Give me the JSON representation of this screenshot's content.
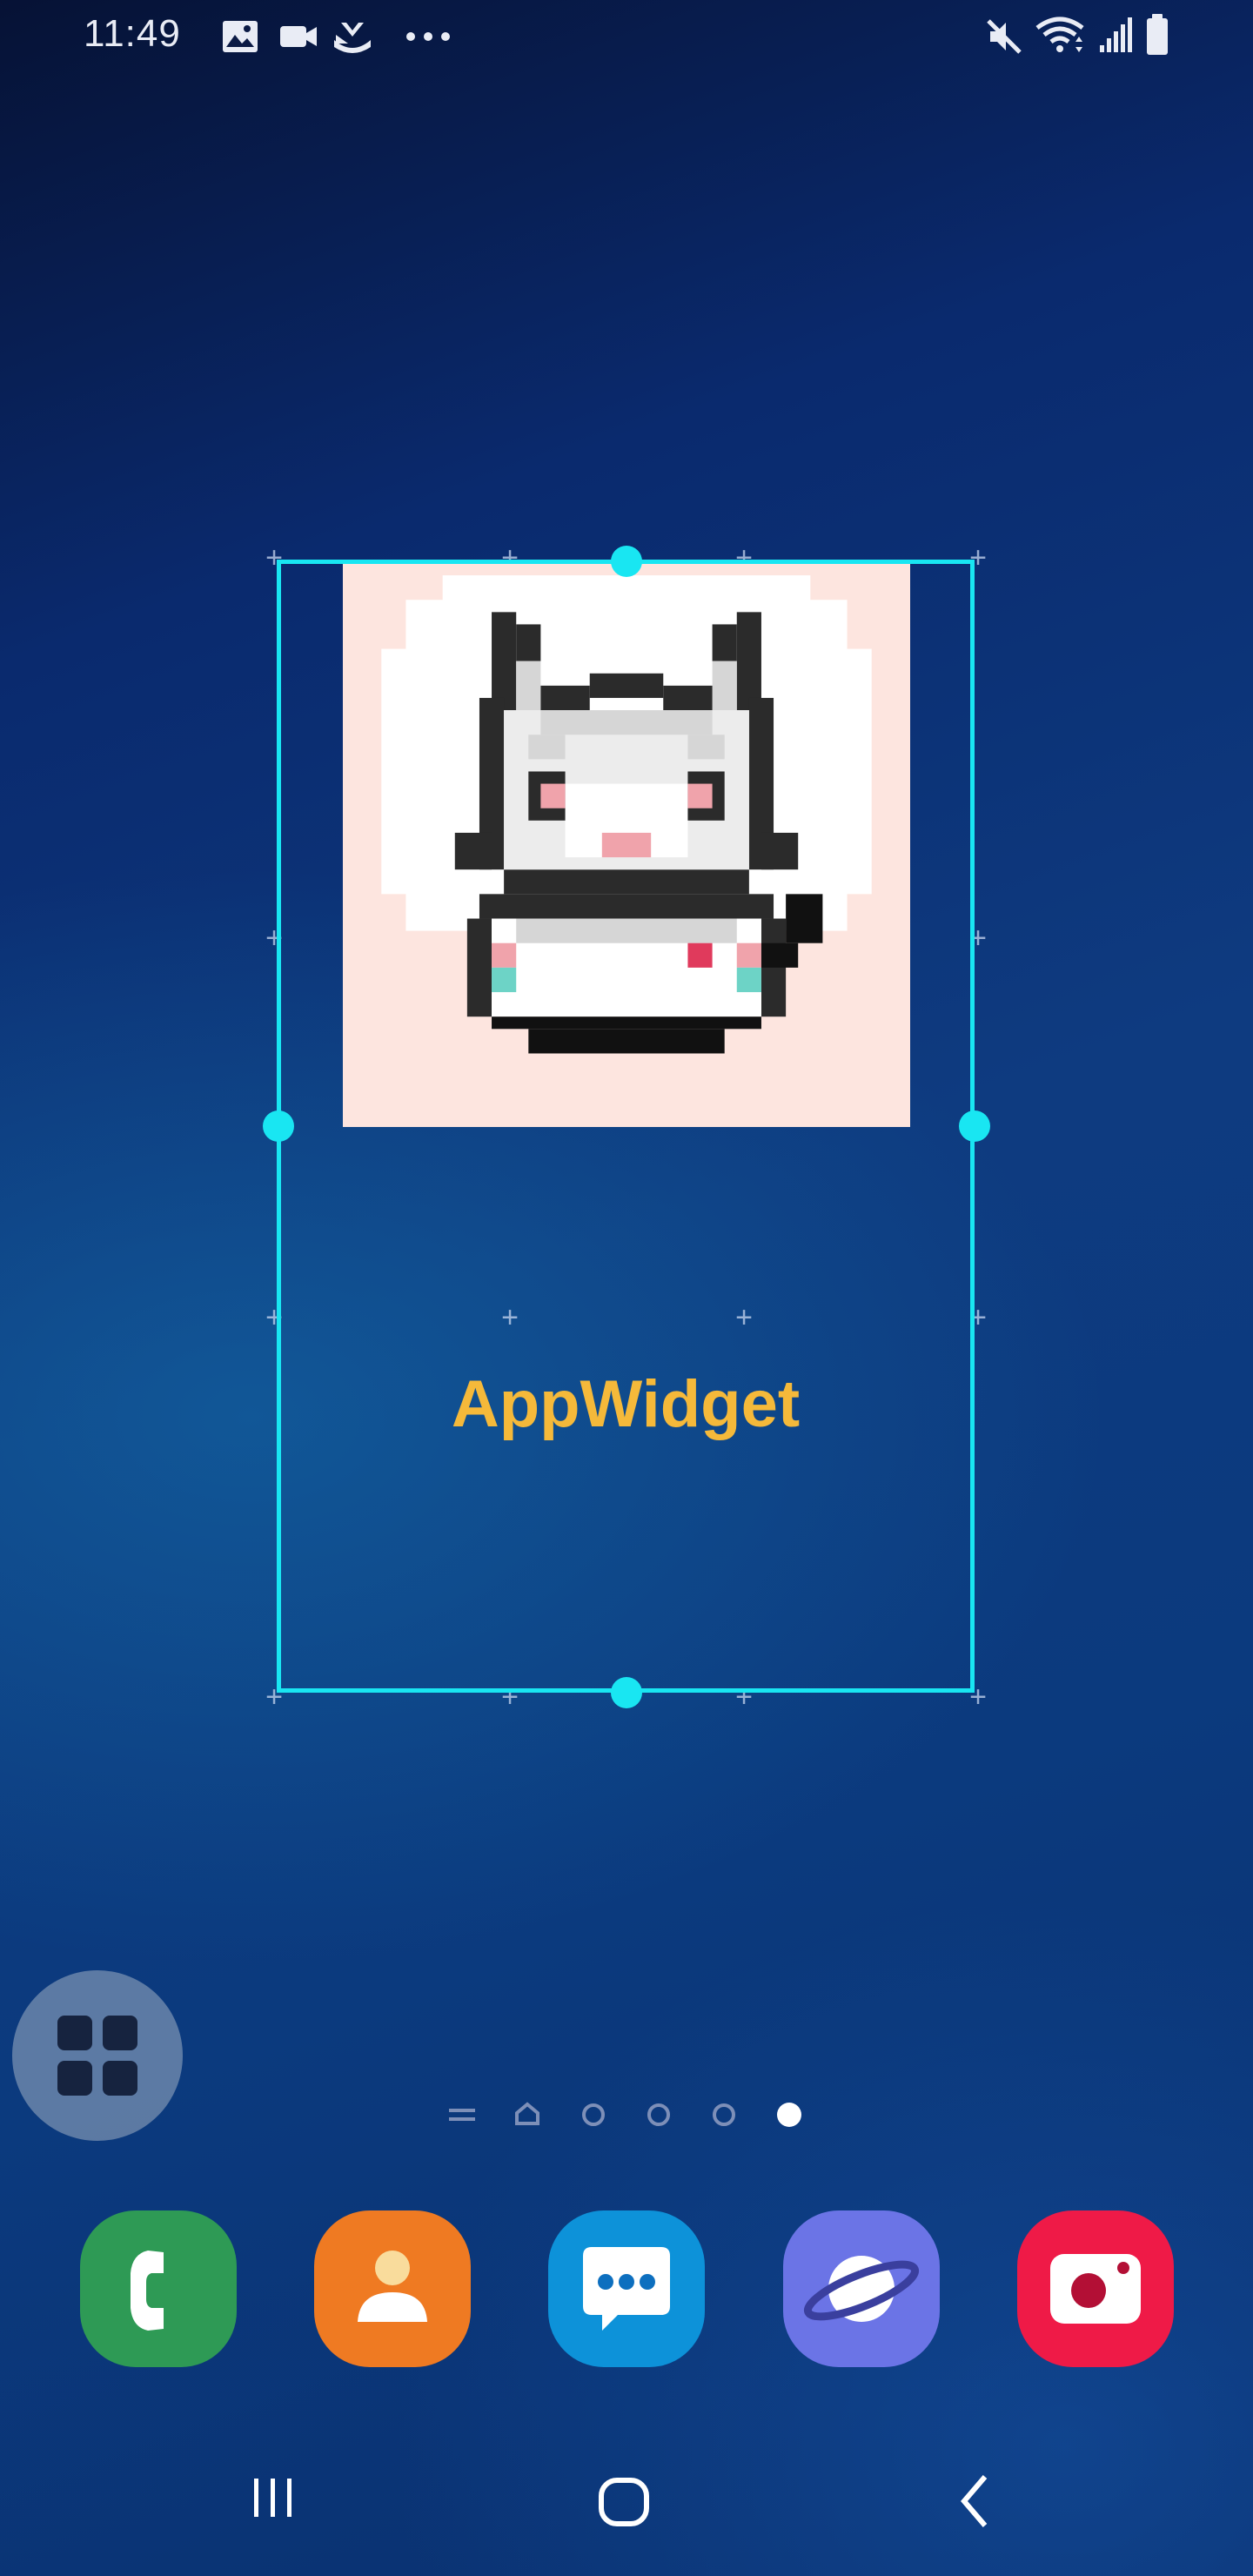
{
  "status_bar": {
    "time": "11:49",
    "left_icons": [
      "image-icon",
      "video-camera-icon",
      "download-tray-icon",
      "more-dots-icon"
    ],
    "right_icons": [
      "mute-icon",
      "wifi-icon",
      "signal-icon",
      "battery-icon"
    ]
  },
  "widget": {
    "label": "AppWidget",
    "image": "pixel-art-cat-icon",
    "frame_color": "#19e6f2",
    "label_color": "#f5b93a",
    "image_bg_color": "#fde5df"
  },
  "home": {
    "apps_button_icon": "apps-grid-icon",
    "page_indicator": {
      "items": [
        "menu-page-icon",
        "home-page-icon",
        "page",
        "page",
        "page",
        "page"
      ],
      "active_index": 5
    }
  },
  "dock": {
    "apps": [
      {
        "name": "phone",
        "icon": "phone-icon",
        "color": "#2e9a55"
      },
      {
        "name": "contacts",
        "icon": "contacts-icon",
        "color": "#ef7a22"
      },
      {
        "name": "messages",
        "icon": "messages-icon",
        "color": "#0d92d9"
      },
      {
        "name": "internet",
        "icon": "internet-icon",
        "color": "#6b74e6"
      },
      {
        "name": "camera",
        "icon": "camera-icon",
        "color": "#ef1a47"
      }
    ]
  },
  "nav_bar": {
    "items": [
      "recents-icon",
      "home-icon",
      "back-icon"
    ]
  }
}
